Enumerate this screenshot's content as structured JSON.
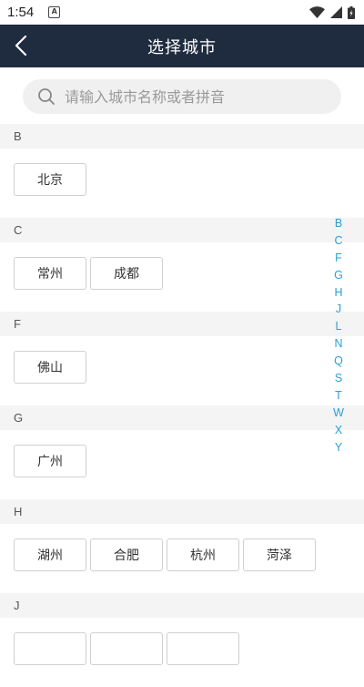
{
  "status_bar": {
    "time": "1:54",
    "notification_icon": "A",
    "icons": [
      "wifi-icon",
      "signal-icon",
      "battery-icon"
    ]
  },
  "header": {
    "title": "选择城市",
    "back_icon": "chevron-left-icon",
    "background": "#1f2b3f"
  },
  "search": {
    "placeholder": "请输入城市名称或者拼音",
    "value": ""
  },
  "sections": [
    {
      "letter": "B",
      "cities": [
        "北京"
      ]
    },
    {
      "letter": "C",
      "cities": [
        "常州",
        "成都"
      ]
    },
    {
      "letter": "F",
      "cities": [
        "佛山"
      ]
    },
    {
      "letter": "G",
      "cities": [
        "广州"
      ]
    },
    {
      "letter": "H",
      "cities": [
        "湖州",
        "合肥",
        "杭州",
        "菏泽"
      ]
    },
    {
      "letter": "J",
      "cities": [
        "",
        "",
        ""
      ]
    }
  ],
  "index_letters": [
    "B",
    "C",
    "F",
    "G",
    "H",
    "J",
    "L",
    "N",
    "Q",
    "S",
    "T",
    "W",
    "X",
    "Y"
  ],
  "colors": {
    "accent": "#2a9fd8",
    "section_bg": "#f4f4f4"
  }
}
